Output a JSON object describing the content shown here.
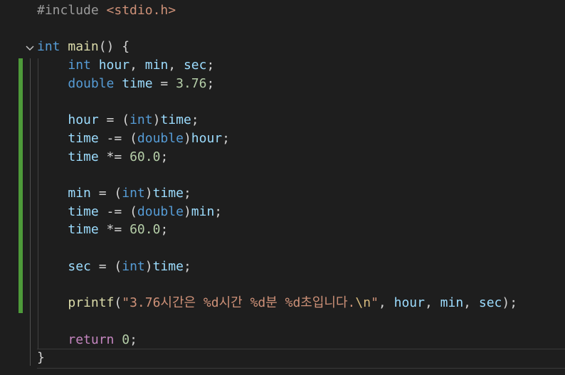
{
  "editor": {
    "lines": [
      {
        "id": "include",
        "parts": [
          [
            "pre",
            "#include "
          ],
          [
            "hdr",
            "<stdio.h>"
          ]
        ]
      },
      {
        "id": "blank1",
        "parts": []
      },
      {
        "id": "main",
        "parts": [
          [
            "kw",
            "int"
          ],
          [
            "plain",
            " "
          ],
          [
            "fn",
            "main"
          ],
          [
            "plain",
            "() {"
          ]
        ]
      },
      {
        "id": "decl1",
        "parts": [
          [
            "plain",
            "    "
          ],
          [
            "kw",
            "int"
          ],
          [
            "plain",
            " "
          ],
          [
            "var",
            "hour"
          ],
          [
            "plain",
            ", "
          ],
          [
            "var",
            "min"
          ],
          [
            "plain",
            ", "
          ],
          [
            "var",
            "sec"
          ],
          [
            "plain",
            ";"
          ]
        ]
      },
      {
        "id": "decl2",
        "parts": [
          [
            "plain",
            "    "
          ],
          [
            "kw",
            "double"
          ],
          [
            "plain",
            " "
          ],
          [
            "var",
            "time"
          ],
          [
            "plain",
            " = "
          ],
          [
            "num",
            "3.76"
          ],
          [
            "plain",
            ";"
          ]
        ]
      },
      {
        "id": "blank2",
        "parts": []
      },
      {
        "id": "hour1",
        "parts": [
          [
            "plain",
            "    "
          ],
          [
            "var",
            "hour"
          ],
          [
            "plain",
            " = ("
          ],
          [
            "kw",
            "int"
          ],
          [
            "plain",
            ")"
          ],
          [
            "var",
            "time"
          ],
          [
            "plain",
            ";"
          ]
        ]
      },
      {
        "id": "hour2",
        "parts": [
          [
            "plain",
            "    "
          ],
          [
            "var",
            "time"
          ],
          [
            "plain",
            " -= ("
          ],
          [
            "kw",
            "double"
          ],
          [
            "plain",
            ")"
          ],
          [
            "var",
            "hour"
          ],
          [
            "plain",
            ";"
          ]
        ]
      },
      {
        "id": "hour3",
        "parts": [
          [
            "plain",
            "    "
          ],
          [
            "var",
            "time"
          ],
          [
            "plain",
            " *= "
          ],
          [
            "num",
            "60.0"
          ],
          [
            "plain",
            ";"
          ]
        ]
      },
      {
        "id": "blank3",
        "parts": []
      },
      {
        "id": "min1",
        "parts": [
          [
            "plain",
            "    "
          ],
          [
            "var",
            "min"
          ],
          [
            "plain",
            " = ("
          ],
          [
            "kw",
            "int"
          ],
          [
            "plain",
            ")"
          ],
          [
            "var",
            "time"
          ],
          [
            "plain",
            ";"
          ]
        ]
      },
      {
        "id": "min2",
        "parts": [
          [
            "plain",
            "    "
          ],
          [
            "var",
            "time"
          ],
          [
            "plain",
            " -= ("
          ],
          [
            "kw",
            "double"
          ],
          [
            "plain",
            ")"
          ],
          [
            "var",
            "min"
          ],
          [
            "plain",
            ";"
          ]
        ]
      },
      {
        "id": "min3",
        "parts": [
          [
            "plain",
            "    "
          ],
          [
            "var",
            "time"
          ],
          [
            "plain",
            " *= "
          ],
          [
            "num",
            "60.0"
          ],
          [
            "plain",
            ";"
          ]
        ]
      },
      {
        "id": "blank4",
        "parts": []
      },
      {
        "id": "sec1",
        "parts": [
          [
            "plain",
            "    "
          ],
          [
            "var",
            "sec"
          ],
          [
            "plain",
            " = ("
          ],
          [
            "kw",
            "int"
          ],
          [
            "plain",
            ")"
          ],
          [
            "var",
            "time"
          ],
          [
            "plain",
            ";"
          ]
        ]
      },
      {
        "id": "blank5",
        "parts": []
      },
      {
        "id": "printf",
        "parts": [
          [
            "plain",
            "    "
          ],
          [
            "fn",
            "printf"
          ],
          [
            "plain",
            "("
          ],
          [
            "str",
            "\"3.76시간은 %d시간 %d분 %d초입니다."
          ],
          [
            "esc",
            "\\n"
          ],
          [
            "str",
            "\""
          ],
          [
            "plain",
            ", "
          ],
          [
            "var",
            "hour"
          ],
          [
            "plain",
            ", "
          ],
          [
            "var",
            "min"
          ],
          [
            "plain",
            ", "
          ],
          [
            "var",
            "sec"
          ],
          [
            "plain",
            ");"
          ]
        ]
      },
      {
        "id": "blank6",
        "parts": []
      },
      {
        "id": "return",
        "parts": [
          [
            "plain",
            "    "
          ],
          [
            "ctl",
            "return"
          ],
          [
            "plain",
            " "
          ],
          [
            "num",
            "0"
          ],
          [
            "plain",
            ";"
          ]
        ]
      },
      {
        "id": "close",
        "parts": [
          [
            "plain",
            "}"
          ]
        ]
      }
    ]
  },
  "icons": {
    "fold": "chevron-down-icon"
  }
}
